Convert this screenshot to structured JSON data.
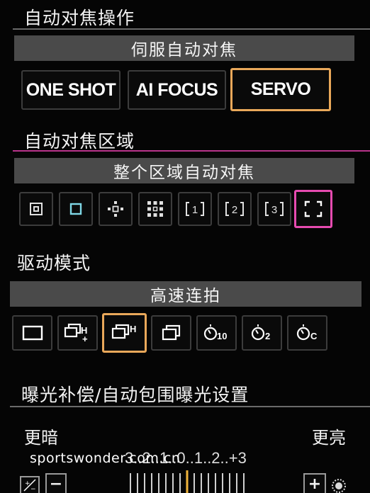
{
  "af_operation": {
    "title": "自动对焦操作",
    "banner": "伺服自动对焦",
    "options": [
      "ONE SHOT",
      "AI FOCUS",
      "SERVO"
    ],
    "selected_index": 2
  },
  "af_area": {
    "title": "自动对焦区域",
    "banner": "整个区域自动对焦",
    "options": [
      {
        "icon": "spot-af-icon"
      },
      {
        "icon": "single-point-af-icon"
      },
      {
        "icon": "expand-af-cross-icon"
      },
      {
        "icon": "expand-af-surround-icon"
      },
      {
        "icon": "zone-af-1-icon",
        "label": "1"
      },
      {
        "icon": "zone-af-2-icon",
        "label": "2"
      },
      {
        "icon": "zone-af-3-icon",
        "label": "3"
      },
      {
        "icon": "whole-area-af-icon"
      }
    ],
    "selected_index": 7
  },
  "drive_mode": {
    "title": "驱动模式",
    "banner": "高速连拍",
    "options": [
      {
        "icon": "single-shot-icon"
      },
      {
        "icon": "high-speed-plus-continuous-icon",
        "label": "H+"
      },
      {
        "icon": "high-speed-continuous-icon",
        "label": "H"
      },
      {
        "icon": "low-speed-continuous-icon"
      },
      {
        "icon": "self-timer-10s-icon",
        "label": "10"
      },
      {
        "icon": "self-timer-2s-icon",
        "label": "2"
      },
      {
        "icon": "self-timer-continuous-icon",
        "label": "C"
      }
    ],
    "selected_index": 2
  },
  "exposure": {
    "title": "曝光补偿/自动包围曝光设置",
    "darker_label": "更暗",
    "brighter_label": "更亮",
    "scale_text": "3..2..1..0..1..2..+3",
    "value": 0,
    "minus_label": "−",
    "plus_label": "+"
  },
  "watermark": "sportswonder.com.cn",
  "colors": {
    "selected_orange": "#e9a85a",
    "selected_pink": "#e64bb0",
    "banner_gray": "#4a4a4a",
    "pointer_yellow": "#f0b43a"
  }
}
